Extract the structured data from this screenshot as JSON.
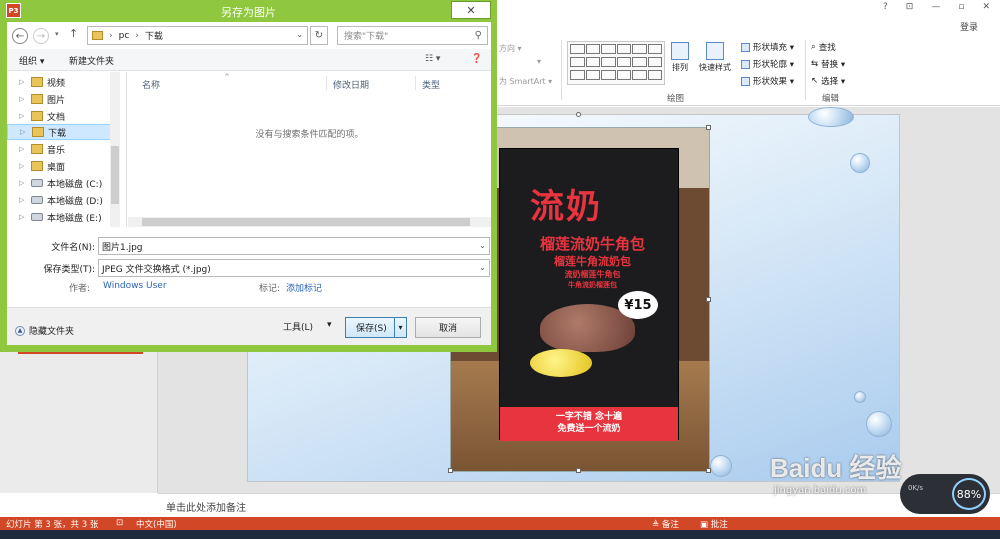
{
  "dialog": {
    "title": "另存为图片",
    "app_badge": "P3",
    "close": "✕",
    "address": {
      "segments": [
        "pc",
        "下载"
      ],
      "sep": "›"
    },
    "search_placeholder": "搜索\"下载\"",
    "toolbar": {
      "organize": "组织 ▾",
      "new_folder": "新建文件夹"
    },
    "nav_items": [
      {
        "label": "视频",
        "kind": "folder"
      },
      {
        "label": "图片",
        "kind": "folder"
      },
      {
        "label": "文档",
        "kind": "folder"
      },
      {
        "label": "下载",
        "kind": "folder",
        "selected": true
      },
      {
        "label": "音乐",
        "kind": "folder"
      },
      {
        "label": "桌面",
        "kind": "folder"
      },
      {
        "label": "本地磁盘 (C:)",
        "kind": "drive"
      },
      {
        "label": "本地磁盘 (D:)",
        "kind": "drive"
      },
      {
        "label": "本地磁盘 (E:)",
        "kind": "drive"
      }
    ],
    "columns": [
      "名称",
      "修改日期",
      "类型"
    ],
    "empty_message": "没有与搜索条件匹配的项。",
    "filename_label": "文件名(N):",
    "filename_value": "图片1.jpg",
    "filetype_label": "保存类型(T):",
    "filetype_value": "JPEG 文件交换格式 (*.jpg)",
    "author_label": "作者:",
    "author_value": "Windows User",
    "tags_label": "标记:",
    "tags_value": "添加标记",
    "hide_folders": "隐藏文件夹",
    "tools": "工具(L)",
    "save": "保存(S)",
    "cancel": "取消"
  },
  "ppt": {
    "window_controls": [
      "?",
      "⊡",
      "—",
      "▫",
      "✕"
    ],
    "login": "登录",
    "ribbon_faint": [
      "方向 ▾",
      "▾",
      "为 SmartArt ▾"
    ],
    "arrange": "排列",
    "quick_styles": "快速样式",
    "shape_fill": "形状填充 ▾",
    "shape_outline": "形状轮廓 ▾",
    "shape_effects": "形状效果 ▾",
    "find": "查找",
    "replace": "替换 ▾",
    "select": "选择 ▾",
    "group_drawing": "绘图",
    "group_editing": "编辑",
    "notes_placeholder": "单击此处添加备注",
    "status": {
      "slide_info": "幻灯片 第 3 张，共 3 张",
      "language": "中文(中国)",
      "notes": "≜ 备注",
      "comments": "▣ 批注"
    },
    "perf": {
      "speed": "0K/s",
      "percent": "88%"
    }
  },
  "slide_image": {
    "title": "流奶",
    "line1": "榴莲流奶牛角包",
    "line2": "榴莲牛角流奶包",
    "line3": "流奶榴莲牛角包",
    "line4": "牛角流奶榴莲包",
    "price": "¥15",
    "banner1": "一字不错 念十遍",
    "banner2": "免费送一个流奶"
  },
  "watermark": {
    "logo": "Baidu 经验",
    "url": "jingyan.baidu.com"
  }
}
